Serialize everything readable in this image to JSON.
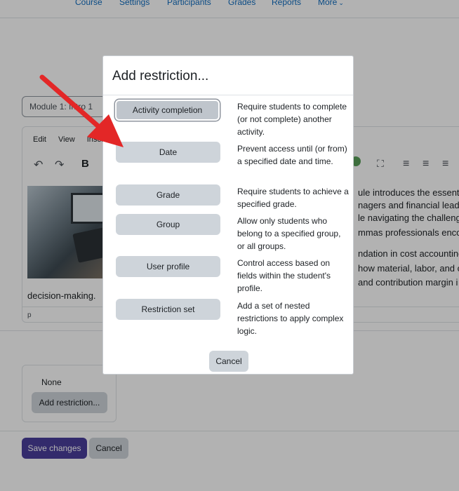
{
  "nav": {
    "items": [
      "Course",
      "Settings",
      "Participants",
      "Grades",
      "Reports"
    ],
    "more_label": "More"
  },
  "form": {
    "name_value": "Module 1: Intro 1"
  },
  "editor": {
    "menu": [
      "Edit",
      "View",
      "Insert"
    ],
    "lines": [
      "ule introduces the essentia",
      "nagers and financial leader",
      "le navigating the challenge",
      "mmas professionals encoun",
      "ndation in cost accounting",
      "how material, labor, and ov",
      " and contribution margin i"
    ],
    "trailing_text": "decision-making.",
    "status_path": "p"
  },
  "restrictions": {
    "none_label": "None",
    "add_label": "Add restriction..."
  },
  "actions": {
    "save_label": "Save changes",
    "cancel_label": "Cancel"
  },
  "modal": {
    "title": "Add restriction...",
    "options": [
      {
        "label": "Activity completion",
        "desc": "Require students to complete (or not complete) another activity."
      },
      {
        "label": "Date",
        "desc": "Prevent access until (or from) a specified date and time."
      },
      {
        "label": "Grade",
        "desc": "Require students to achieve a specified grade."
      },
      {
        "label": "Group",
        "desc": "Allow only students who belong to a specified group, or all groups."
      },
      {
        "label": "User profile",
        "desc": "Control access based on fields within the student's profile."
      },
      {
        "label": "Restriction set",
        "desc": "Add a set of nested restrictions to apply complex logic."
      }
    ],
    "cancel_label": "Cancel"
  },
  "colors": {
    "primary": "#4a3e9b",
    "secondary_button": "#ced4da",
    "link": "#0f6cbf",
    "annotation_arrow": "#e32727"
  }
}
